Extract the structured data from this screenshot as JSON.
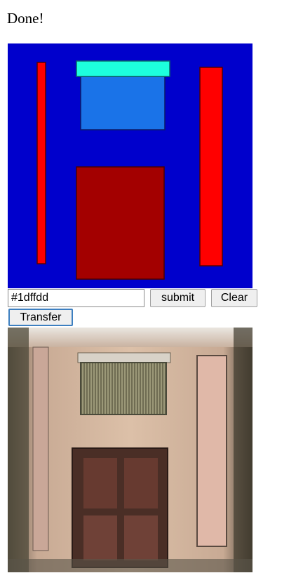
{
  "status": {
    "text": "Done!"
  },
  "controls": {
    "color_value": "#1dffdd",
    "submit_label": "submit",
    "clear_label": "Clear",
    "transfer_label": "Transfer"
  },
  "colors": {
    "canvas_background": "#0000cc",
    "pillar": "#ff0000",
    "cornice": "#1dffdd",
    "window": "#1a73e8",
    "door": "#a30000"
  },
  "panels": {
    "label_map": {
      "type": "drawing-canvas"
    },
    "generated": {
      "type": "generated-facade-image"
    }
  }
}
